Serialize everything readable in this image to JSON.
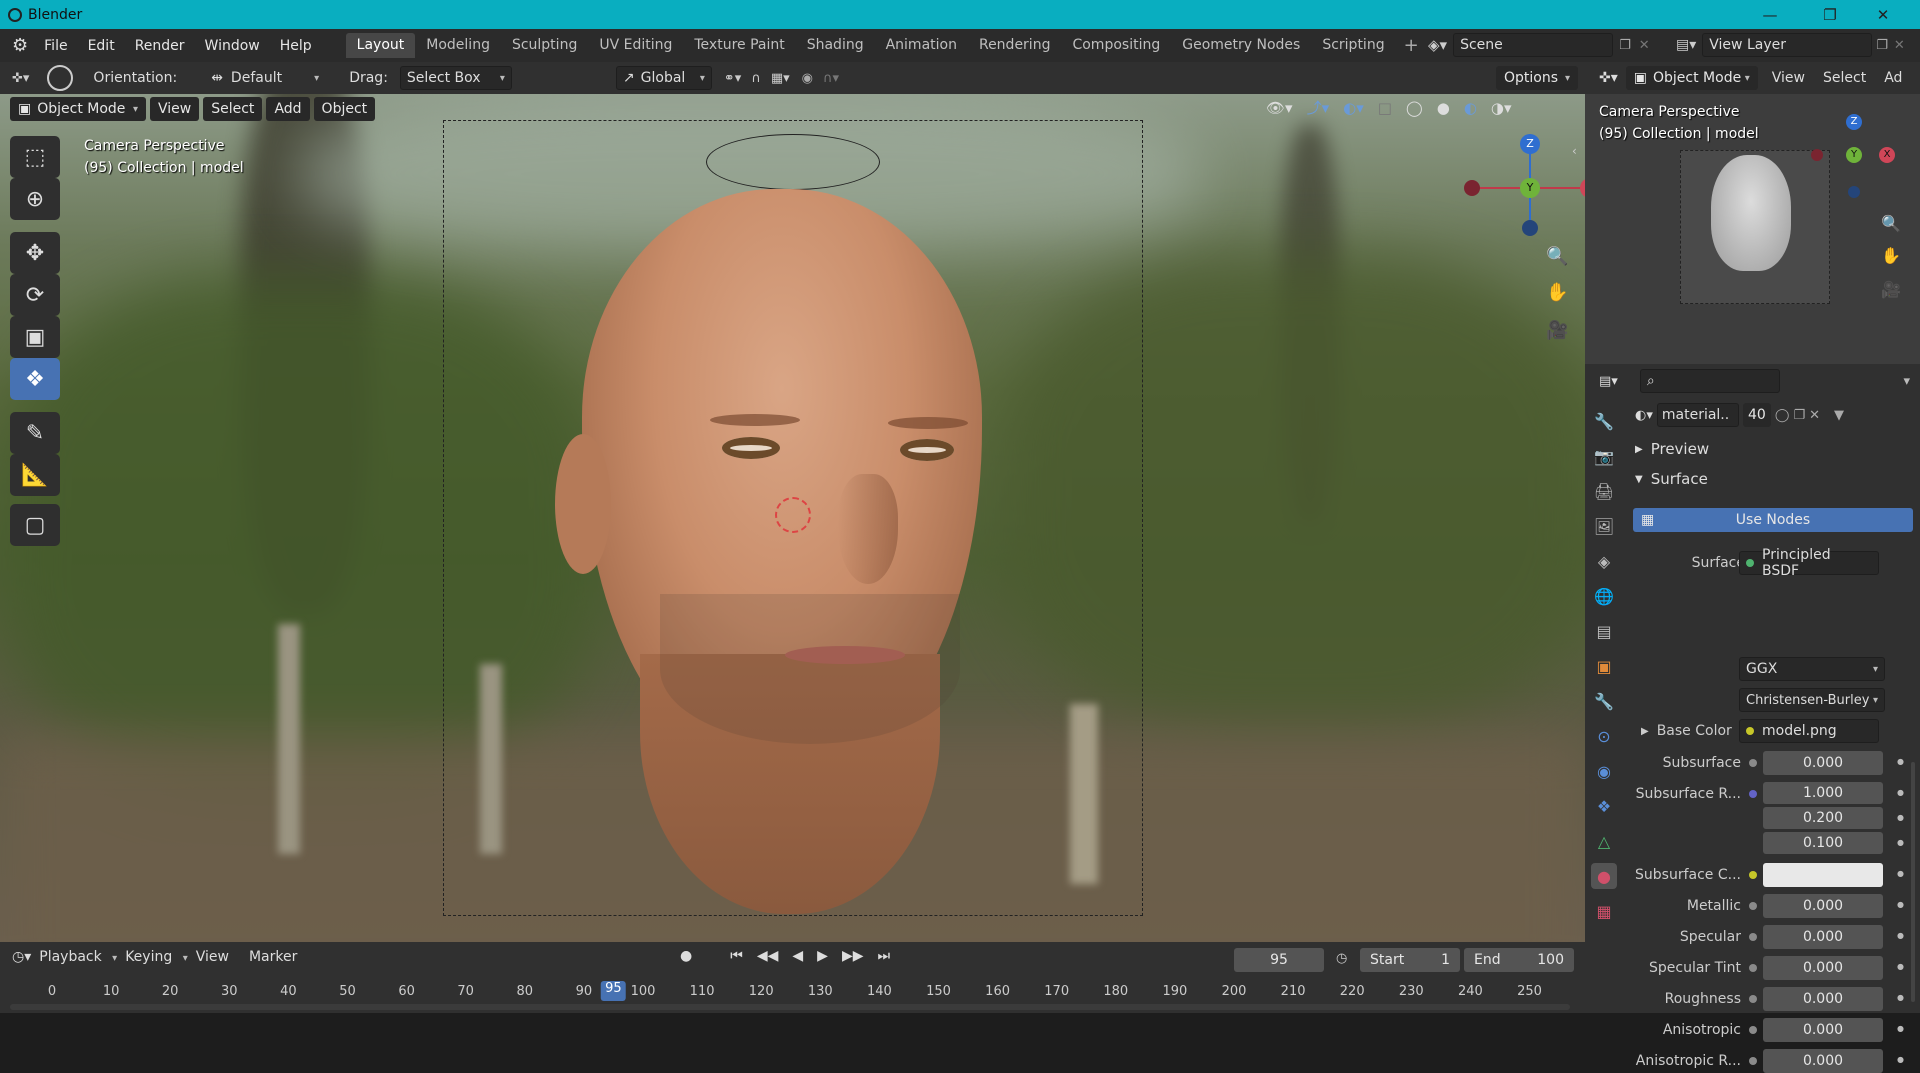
{
  "window": {
    "title": "Blender"
  },
  "menu": [
    "File",
    "Edit",
    "Render",
    "Window",
    "Help"
  ],
  "workspaces": [
    "Layout",
    "Modeling",
    "Sculpting",
    "UV Editing",
    "Texture Paint",
    "Shading",
    "Animation",
    "Rendering",
    "Compositing",
    "Geometry Nodes",
    "Scripting"
  ],
  "active_workspace": "Layout",
  "scene": {
    "name": "Scene",
    "view_layer": "View Layer"
  },
  "toolheader": {
    "orientation_label": "Orientation:",
    "orientation_value": "Default",
    "drag_label": "Drag:",
    "drag_value": "Select Box",
    "transform_orientation": "Global",
    "options": "Options"
  },
  "viewport_header": {
    "mode": "Object Mode",
    "view": "View",
    "select": "Select",
    "add": "Add",
    "object": "Object"
  },
  "viewport_overlay": {
    "line1": "Camera Perspective",
    "line2": "(95) Collection | model"
  },
  "gizmo": {
    "z": "Z",
    "y": "Y",
    "x": "X"
  },
  "preview": {
    "mode": "Object Mode",
    "view": "View",
    "select": "Select",
    "add": "Ad",
    "line1": "Camera Perspective",
    "line2": "(95) Collection | model"
  },
  "timeline": {
    "playback": "Playback",
    "keying": "Keying",
    "view": "View",
    "marker": "Marker",
    "current_frame": "95",
    "start_label": "Start",
    "start": "1",
    "end_label": "End",
    "end": "100",
    "ticks": [
      "0",
      "10",
      "20",
      "30",
      "40",
      "50",
      "60",
      "70",
      "80",
      "90",
      "100",
      "110",
      "120",
      "130",
      "140",
      "150",
      "160",
      "170",
      "180",
      "190",
      "200",
      "210",
      "220",
      "230",
      "240",
      "250"
    ]
  },
  "properties": {
    "material_name": "material..",
    "user_count": "40",
    "preview_panel": "Preview",
    "surface_panel": "Surface",
    "use_nodes": "Use Nodes",
    "surface_label": "Surface",
    "surface_shader": "Principled BSDF",
    "distribution": "GGX",
    "subsurface_method": "Christensen-Burley",
    "base_color_label": "Base Color",
    "base_color_value": "model.png",
    "rows": [
      {
        "label": "Subsurface",
        "value": "0.000",
        "socket": "#8a8a8a"
      },
      {
        "label": "Subsurface R...",
        "value": "1.000",
        "socket": "#6363c7"
      },
      {
        "label": "",
        "value": "0.200",
        "socket": ""
      },
      {
        "label": "",
        "value": "0.100",
        "socket": ""
      },
      {
        "label": "Subsurface C...",
        "value": "",
        "socket": "#c7c729"
      },
      {
        "label": "Metallic",
        "value": "0.000",
        "socket": "#8a8a8a"
      },
      {
        "label": "Specular",
        "value": "0.000",
        "socket": "#8a8a8a"
      },
      {
        "label": "Specular Tint",
        "value": "0.000",
        "socket": "#8a8a8a"
      },
      {
        "label": "Roughness",
        "value": "0.000",
        "socket": "#8a8a8a"
      },
      {
        "label": "Anisotropic",
        "value": "0.000",
        "socket": "#8a8a8a"
      },
      {
        "label": "Anisotropic R...",
        "value": "0.000",
        "socket": "#8a8a8a"
      }
    ]
  },
  "colors": {
    "accent": "#4772b3",
    "titlebar": "#09aec0",
    "current_frame": "#4772b3"
  }
}
